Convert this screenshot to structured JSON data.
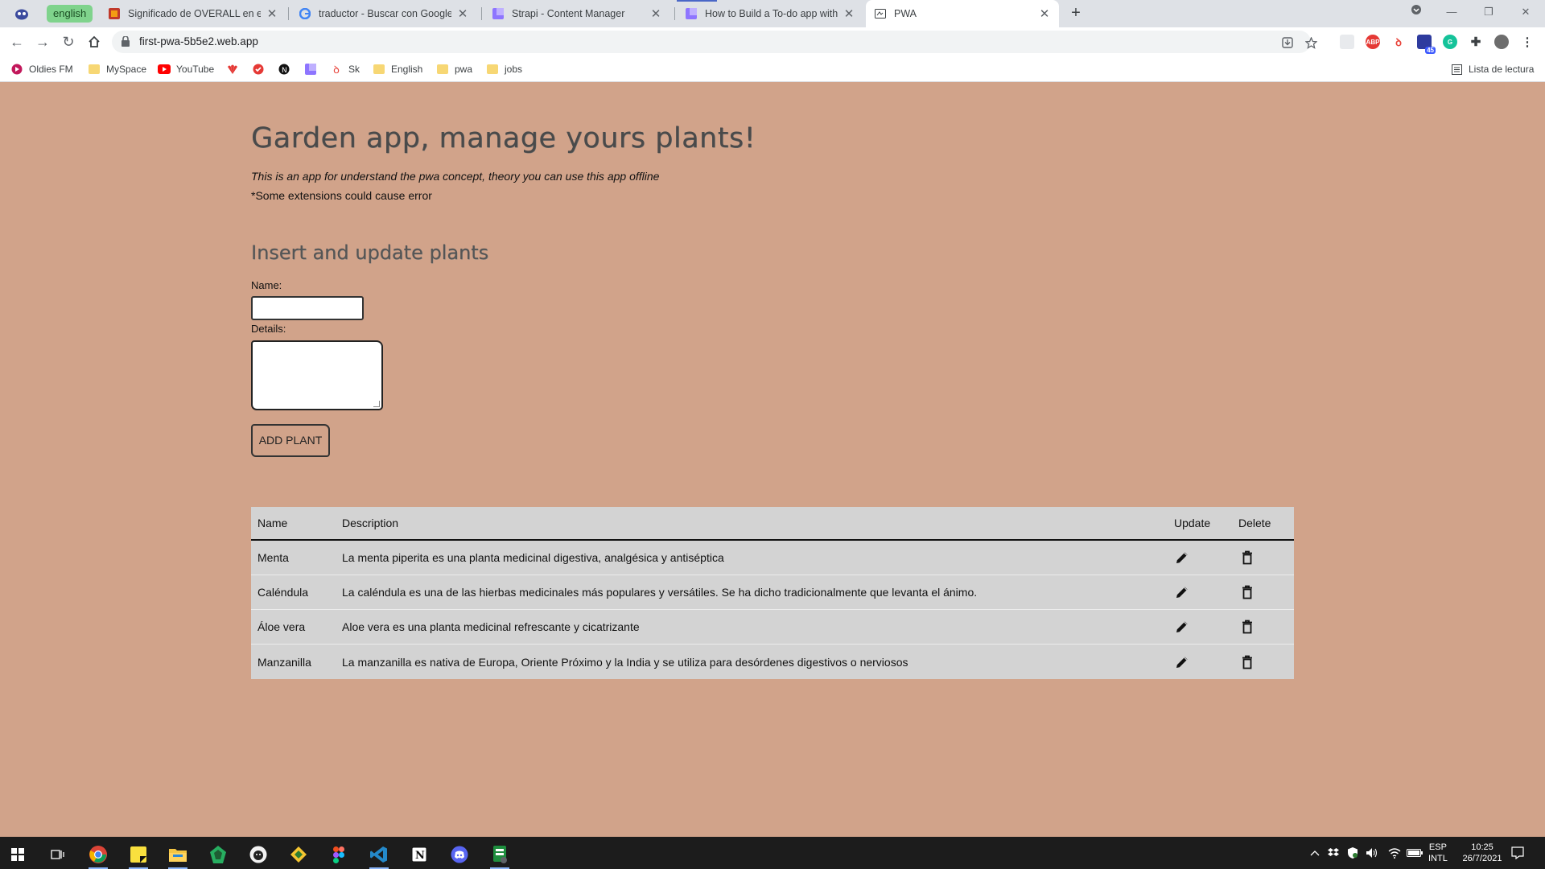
{
  "browser": {
    "tab_group_label": "english",
    "tabs": [
      {
        "title": "Significado de OVERALL en el Diccionario",
        "favicon": "dictionary-icon"
      },
      {
        "title": "traductor - Buscar con Google",
        "favicon": "google-icon"
      },
      {
        "title": "Strapi - Content Manager",
        "favicon": "strapi-icon"
      },
      {
        "title": "How to Build a To-do app with Strapi",
        "favicon": "strapi-icon"
      },
      {
        "title": "PWA",
        "favicon": "pwa-icon"
      }
    ],
    "url": "first-pwa-5b5e2.web.app",
    "bookmarks": [
      {
        "label": "Oldies FM"
      },
      {
        "label": "MySpace"
      },
      {
        "label": "YouTube"
      },
      {
        "label": ""
      },
      {
        "label": ""
      },
      {
        "label": ""
      },
      {
        "label": ""
      },
      {
        "label": "Sk"
      },
      {
        "label": "English"
      },
      {
        "label": "pwa"
      },
      {
        "label": "jobs"
      }
    ],
    "reading_list": "Lista de lectura",
    "extension_badge": "45"
  },
  "page": {
    "title": "Garden app, manage yours plants!",
    "intro": "This is an app for understand the pwa concept, theory you can use this app offline",
    "note": "*Some extensions could cause error",
    "form_title": "Insert and update plants",
    "name_label": "Name:",
    "name_value": "",
    "details_label": "Details:",
    "details_value": "",
    "add_button": "ADD PLANT",
    "table": {
      "headers": {
        "name": "Name",
        "description": "Description",
        "update": "Update",
        "delete": "Delete"
      },
      "rows": [
        {
          "name": "Menta",
          "description": "La menta piperita es una planta medicinal digestiva, analgésica y antiséptica"
        },
        {
          "name": "Caléndula",
          "description": "La caléndula es una de las hierbas medicinales más populares y versátiles. Se ha dicho tradicionalmente que levanta el ánimo."
        },
        {
          "name": "Áloe vera",
          "description": "Aloe vera es una planta medicinal refrescante y cicatrizante"
        },
        {
          "name": "Manzanilla",
          "description": "La manzanilla es nativa de Europa, Oriente Próximo y la India y se utiliza para desórdenes digestivos o nerviosos"
        }
      ]
    }
  },
  "taskbar": {
    "language": "ESP",
    "layout": "INTL",
    "time": "10:25",
    "date": "26/7/2021"
  }
}
